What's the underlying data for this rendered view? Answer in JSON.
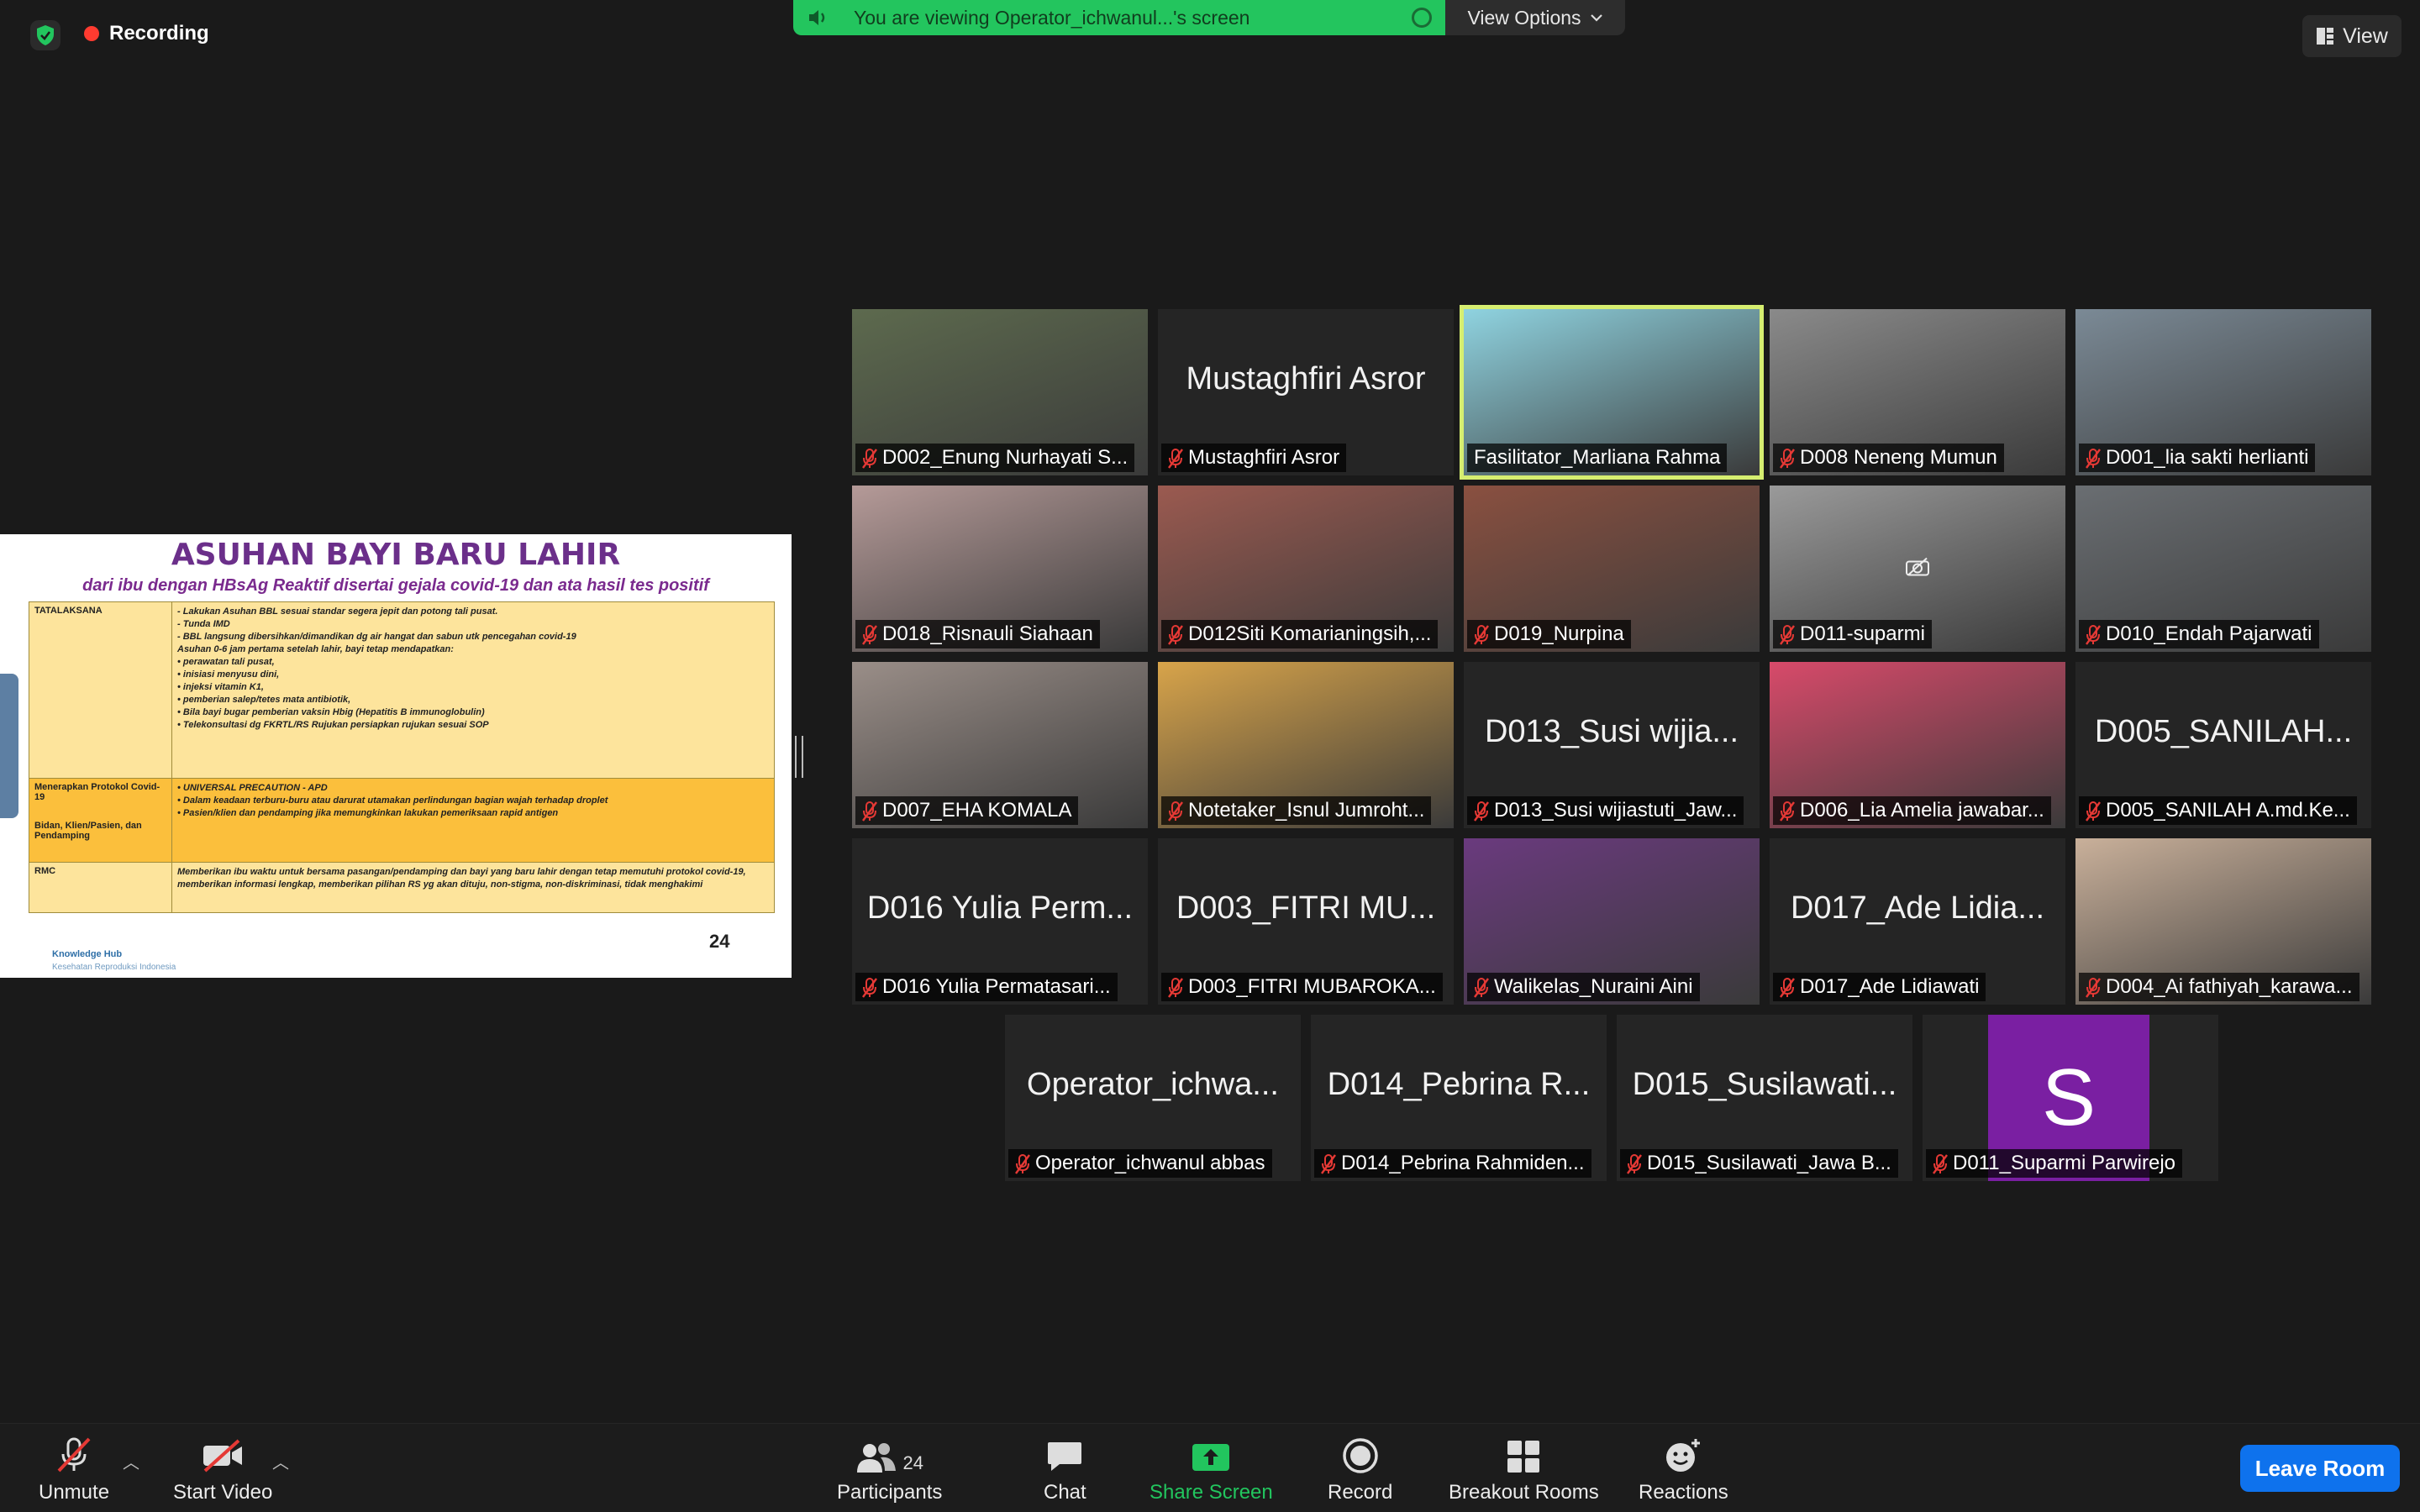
{
  "top": {
    "recording_label": "Recording",
    "share_banner_text": "You are viewing Operator_ichwanul...'s screen",
    "view_options_label": "View Options",
    "view_label": "View"
  },
  "slide": {
    "title": "ASUHAN BAYI BARU LAHIR",
    "subtitle": "dari ibu dengan HBsAg Reaktif disertai gejala covid-19 dan ata hasil tes positif",
    "row1_label": "TATALAKSANA",
    "row1_items": [
      "-   Lakukan Asuhan BBL sesuai standar segera jepit dan potong tali pusat.",
      "-   Tunda IMD",
      "-   BBL langsung dibersihkan/dimandikan dg air hangat dan sabun utk pencegahan covid-19",
      "Asuhan 0-6 jam pertama setelah lahir, bayi tetap mendapatkan:",
      "•   perawatan tali pusat,",
      "•   inisiasi menyusu dini,",
      "•   injeksi vitamin K1,",
      "•   pemberian salep/tetes mata antibiotik,",
      "•   Bila bayi bugar pemberian vaksin Hbig (Hepatitis B immunoglobulin)",
      "•   Telekonsultasi dg FKRTL/RS Rujukan persiapkan rujukan sesuai SOP"
    ],
    "row2_label_a": "Menerapkan Protokol Covid-19",
    "row2_label_b": "Bidan, Klien/Pasien, dan Pendamping",
    "row2_items": [
      "•   UNIVERSAL PRECAUTION - APD",
      "•   Dalam keadaan terburu-buru atau darurat utamakan perlindungan bagian wajah terhadap droplet",
      "•   Pasien/klien dan pendamping jika memungkinkan lakukan pemeriksaan rapid antigen"
    ],
    "row3_label": "RMC",
    "row3_text": "Memberikan ibu waktu untuk bersama pasangan/pendamping dan bayi yang baru lahir dengan tetap memutuhi protokol covid-19, memberikan informasi lengkap, memberikan pilihan RS yg akan dituju, non-stigma, non-diskriminasi, tidak menghakimi",
    "footer_brand": "Knowledge Hub",
    "footer_sub": "Kesehatan Reproduksi Indonesia",
    "page_number": "24"
  },
  "tiles": [
    {
      "label": "D002_Enung Nurhayati S...",
      "big": "",
      "bg": "#5d6a4e",
      "video": true
    },
    {
      "label": "Mustaghfiri Asror",
      "big": "Mustaghfiri Asror",
      "bg": "#252525",
      "video": false
    },
    {
      "label": "Fasilitator_Marliana Rahma",
      "big": "",
      "bg": "#8fd3e0",
      "video": true
    },
    {
      "label": "D008 Neneng Mumun",
      "big": "",
      "bg": "#8a8a8a",
      "video": true
    },
    {
      "label": "D001_lia sakti herlianti",
      "big": "",
      "bg": "#7b8a96",
      "video": true
    },
    {
      "label": "D018_Risnauli Siahaan",
      "big": "",
      "bg": "#b59a98",
      "video": true
    },
    {
      "label": "D012Siti Komarianingsih,...",
      "big": "",
      "bg": "#9b5a50",
      "video": true
    },
    {
      "label": "D019_Nurpina",
      "big": "",
      "bg": "#8a5040",
      "video": true
    },
    {
      "label": "D011-suparmi",
      "big": "",
      "bg": "#9a9a9a",
      "video": true
    },
    {
      "label": "D010_Endah Pajarwati",
      "big": "",
      "bg": "#6a6e72",
      "video": true
    },
    {
      "label": "D007_EHA KOMALA",
      "big": "",
      "bg": "#9a8e88",
      "video": true
    },
    {
      "label": "Notetaker_Isnul Jumroht...",
      "big": "",
      "bg": "#d8a44a",
      "video": true
    },
    {
      "label": "D013_Susi wijiastuti_Jaw...",
      "big": "D013_Susi wijia...",
      "bg": "#252525",
      "video": false
    },
    {
      "label": "D006_Lia Amelia jawabar...",
      "big": "",
      "bg": "#d84a6a",
      "video": true
    },
    {
      "label": "D005_SANILAH A.md.Ke...",
      "big": "D005_SANILAH...",
      "bg": "#252525",
      "video": false
    },
    {
      "label": "D016 Yulia Permatasari...",
      "big": "D016 Yulia Perm...",
      "bg": "#252525",
      "video": false
    },
    {
      "label": "D003_FITRI MUBAROKA...",
      "big": "D003_FITRI MU...",
      "bg": "#252525",
      "video": false
    },
    {
      "label": "Walikelas_Nuraini Aini",
      "big": "",
      "bg": "#6a3a7e",
      "video": true
    },
    {
      "label": "D017_Ade Lidiawati",
      "big": "D017_Ade Lidia...",
      "bg": "#252525",
      "video": false
    },
    {
      "label": "D004_Ai fathiyah_karawa...",
      "big": "",
      "bg": "#c9b09a",
      "video": true
    },
    {
      "label": "Operator_ichwanul abbas",
      "big": "Operator_ichwa...",
      "bg": "#252525",
      "video": false
    },
    {
      "label": "D014_Pebrina Rahmiden...",
      "big": "D014_Pebrina R...",
      "bg": "#252525",
      "video": false
    },
    {
      "label": "D015_Susilawati_Jawa B...",
      "big": "D015_Susilawati...",
      "bg": "#252525",
      "video": false
    },
    {
      "label": "D011_Suparmi Parwirejo",
      "big": "S",
      "bg": "#252525",
      "video": false
    }
  ],
  "toolbar": {
    "unmute": "Unmute",
    "start_video": "Start Video",
    "participants": "Participants",
    "participants_count": "24",
    "chat": "Chat",
    "share_screen": "Share Screen",
    "record": "Record",
    "breakout_rooms": "Breakout Rooms",
    "reactions": "Reactions",
    "leave_room": "Leave Room"
  },
  "colors": {
    "share_green": "#23c55e",
    "active_speaker": "#d6ee70",
    "mic_muted_red": "#e53935",
    "leave_blue": "#0e72ed",
    "avatar_purple": "#7a1fa2"
  }
}
